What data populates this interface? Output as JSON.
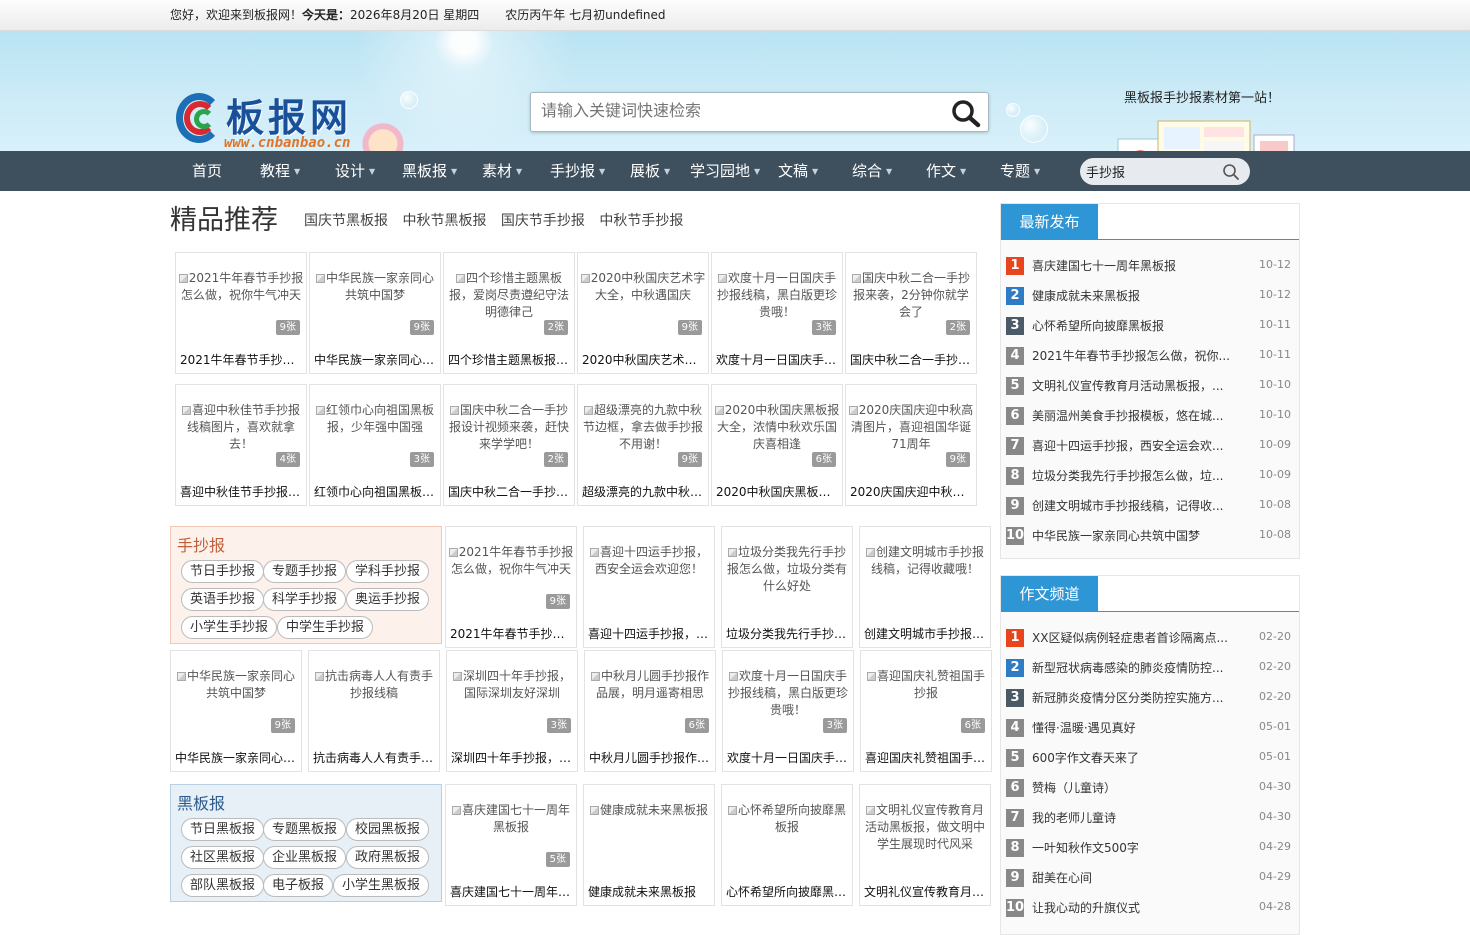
{
  "topbar": {
    "welcome": "您好，欢迎来到板报网！",
    "today_label": "今天是：",
    "date": "2026年8月20日  星期四",
    "lunar": "农历丙午年 七月初undefined"
  },
  "header": {
    "logo_name": "板报网",
    "logo_url": "www.cnbanbao.cn",
    "search_placeholder": "请输入关键词快速检索",
    "slogan": "黑板报手抄报素材第一站！"
  },
  "nav": {
    "items": [
      {
        "label": "首页",
        "dropdown": false
      },
      {
        "label": "教程",
        "dropdown": true
      },
      {
        "label": "设计",
        "dropdown": true
      },
      {
        "label": "黑板报",
        "dropdown": true
      },
      {
        "label": "素材",
        "dropdown": true
      },
      {
        "label": "手抄报",
        "dropdown": true
      },
      {
        "label": "展板",
        "dropdown": true
      },
      {
        "label": "学习园地",
        "dropdown": true
      },
      {
        "label": "文稿",
        "dropdown": true
      },
      {
        "label": "综合",
        "dropdown": true
      },
      {
        "label": "作文",
        "dropdown": true
      },
      {
        "label": "专题",
        "dropdown": true
      }
    ],
    "search_value": "手抄报"
  },
  "featured": {
    "title": "精品推荐",
    "links": [
      "国庆节黑板报",
      "中秋节黑板报",
      "国庆节手抄报",
      "中秋节手抄报"
    ],
    "cards": [
      {
        "alt": "2021牛年春节手抄报怎么做，祝你牛气冲天",
        "count": "9张",
        "caption": "2021牛年春节手抄报怎么做，祝你牛气冲天"
      },
      {
        "alt": "中华民族一家亲同心共筑中国梦",
        "count": "9张",
        "caption": "中华民族一家亲同心共筑中国梦"
      },
      {
        "alt": "四个珍惜主题黑板报，爱岗尽责遵纪守法明德律己",
        "count": "2张",
        "caption": "四个珍惜主题黑板报，爱岗尽责遵纪守法明德律己"
      },
      {
        "alt": "2020中秋国庆艺术字大全，中秋遇国庆",
        "count": "9张",
        "caption": "2020中秋国庆艺术字大全，中秋遇国庆"
      },
      {
        "alt": "欢度十月一日国庆手抄报线稿，黑白版更珍贵哦！",
        "count": "3张",
        "caption": "欢度十月一日国庆手抄报线稿，黑白版更珍贵哦！"
      },
      {
        "alt": "国庆中秋二合一手抄报来袭，2分钟你就学会了",
        "count": "2张",
        "caption": "国庆中秋二合一手抄报来袭，2分钟你就学会了"
      },
      {
        "alt": "喜迎中秋佳节手抄报线稿图片，喜欢就拿去！",
        "count": "4张",
        "caption": "喜迎中秋佳节手抄报线稿图片，喜欢就拿去！"
      },
      {
        "alt": "红领巾心向祖国黑板报，少年强中国强",
        "count": "3张",
        "caption": "红领巾心向祖国黑板报，少年强中国强"
      },
      {
        "alt": "国庆中秋二合一手抄报设计视频来袭，赶快来学学吧！",
        "count": "2张",
        "caption": "国庆中秋二合一手抄报设计视频来袭，赶快来学学吧！"
      },
      {
        "alt": "超级漂亮的九款中秋节边框，拿去做手抄报不用谢！",
        "count": "9张",
        "caption": "超级漂亮的九款中秋节边框，拿去做手抄报不用谢！"
      },
      {
        "alt": "2020中秋国庆黑板报大全，浓情中秋欢乐国庆喜相逢",
        "count": "6张",
        "caption": "2020中秋国庆黑板报大全，浓情中秋欢乐国庆喜相逢"
      },
      {
        "alt": "2020庆国庆迎中秋高清图片，喜迎祖国华诞71周年",
        "count": "9张",
        "caption": "2020庆国庆迎中秋高清图片，喜迎祖国华诞71周年"
      }
    ]
  },
  "shouchaobao": {
    "title": "手抄报",
    "tags": [
      "节日手抄报",
      "专题手抄报",
      "学科手抄报",
      "英语手抄报",
      "科学手抄报",
      "奥运手抄报",
      "小学生手抄报",
      "中学生手抄报"
    ],
    "cards": [
      {
        "alt": "2021牛年春节手抄报怎么做，祝你牛气冲天",
        "count": "9张",
        "caption": "2021牛年春节手抄报怎么做，祝你牛气冲天"
      },
      {
        "alt": "喜迎十四运手抄报，西安全运会欢迎您！",
        "count": "",
        "caption": "喜迎十四运手抄报，西安全运会欢迎您！"
      },
      {
        "alt": "垃圾分类我先行手抄报怎么做，垃圾分类有什么好处",
        "count": "",
        "caption": "垃圾分类我先行手抄报怎么做，垃圾分类有什么好处"
      },
      {
        "alt": "创建文明城市手抄报线稿，记得收藏哦！",
        "count": "",
        "caption": "创建文明城市手抄报线稿，记得收藏哦！"
      },
      {
        "alt": "中华民族一家亲同心共筑中国梦",
        "count": "9张",
        "caption": "中华民族一家亲同心共筑中国梦"
      },
      {
        "alt": "抗击病毒人人有责手抄报线稿",
        "count": "",
        "caption": "抗击病毒人人有责手抄报线稿"
      },
      {
        "alt": "深圳四十年手抄报，国际深圳友好深圳",
        "count": "3张",
        "caption": "深圳四十年手抄报，国际深圳友好深圳"
      },
      {
        "alt": "中秋月儿圆手抄报作品展，明月遥寄相思",
        "count": "6张",
        "caption": "中秋月儿圆手抄报作品展，明月遥寄相思"
      },
      {
        "alt": "欢度十月一日国庆手抄报线稿，黑白版更珍贵哦！",
        "count": "3张",
        "caption": "欢度十月一日国庆手抄报线稿，黑白版更珍贵哦！"
      },
      {
        "alt": "喜迎国庆礼赞祖国手抄报",
        "count": "6张",
        "caption": "喜迎国庆礼赞祖国手抄报"
      }
    ]
  },
  "heibanbao": {
    "title": "黑板报",
    "tags": [
      "节日黑板报",
      "专题黑板报",
      "校园黑板报",
      "社区黑板报",
      "企业黑板报",
      "政府黑板报",
      "部队黑板报",
      "电子板报",
      "小学生黑板报"
    ],
    "cards": [
      {
        "alt": "喜庆建国七十一周年黑板报",
        "count": "5张",
        "caption": "喜庆建国七十一周年黑板报"
      },
      {
        "alt": "健康成就未来黑板报",
        "count": "",
        "caption": "健康成就未来黑板报"
      },
      {
        "alt": "心怀希望所向披靡黑板报",
        "count": "",
        "caption": "心怀希望所向披靡黑板报"
      },
      {
        "alt": "文明礼仪宣传教育月活动黑板报，做文明中学生展现时代风采",
        "count": "",
        "caption": "文明礼仪宣传教育月活动黑板报，做文明中学生展现时代风采"
      }
    ]
  },
  "latest": {
    "title": "最新发布",
    "items": [
      {
        "n": "1",
        "title": "喜庆建国七十一周年黑板报",
        "date": "10-12"
      },
      {
        "n": "2",
        "title": "健康成就未来黑板报",
        "date": "10-12"
      },
      {
        "n": "3",
        "title": "心怀希望所向披靡黑板报",
        "date": "10-11"
      },
      {
        "n": "4",
        "title": "2021牛年春节手抄报怎么做，祝你...",
        "date": "10-11"
      },
      {
        "n": "5",
        "title": "文明礼仪宣传教育月活动黑板报，...",
        "date": "10-10"
      },
      {
        "n": "6",
        "title": "美丽温州美食手抄报模板，悠在城...",
        "date": "10-10"
      },
      {
        "n": "7",
        "title": "喜迎十四运手抄报，西安全运会欢...",
        "date": "10-09"
      },
      {
        "n": "8",
        "title": "垃圾分类我先行手抄报怎么做，垃...",
        "date": "10-09"
      },
      {
        "n": "9",
        "title": "创建文明城市手抄报线稿，记得收...",
        "date": "10-08"
      },
      {
        "n": "10",
        "title": "中华民族一家亲同心共筑中国梦",
        "date": "10-08"
      }
    ]
  },
  "essay": {
    "title": "作文频道",
    "items": [
      {
        "n": "1",
        "title": "XX区疑似病例轻症患者首诊隔离点...",
        "date": "02-20"
      },
      {
        "n": "2",
        "title": "新型冠状病毒感染的肺炎疫情防控...",
        "date": "02-20"
      },
      {
        "n": "3",
        "title": "新冠肺炎疫情分区分类防控实施方...",
        "date": "02-20"
      },
      {
        "n": "4",
        "title": "懂得·温暖·遇见真好",
        "date": "05-01"
      },
      {
        "n": "5",
        "title": "600字作文春天来了",
        "date": "05-01"
      },
      {
        "n": "6",
        "title": "赞梅（儿童诗）",
        "date": "04-30"
      },
      {
        "n": "7",
        "title": "我的老师儿童诗",
        "date": "04-30"
      },
      {
        "n": "8",
        "title": "一叶知秋作文500字",
        "date": "04-29"
      },
      {
        "n": "9",
        "title": "甜美在心间",
        "date": "04-29"
      },
      {
        "n": "10",
        "title": "让我心动的升旗仪式",
        "date": "04-28"
      }
    ]
  }
}
